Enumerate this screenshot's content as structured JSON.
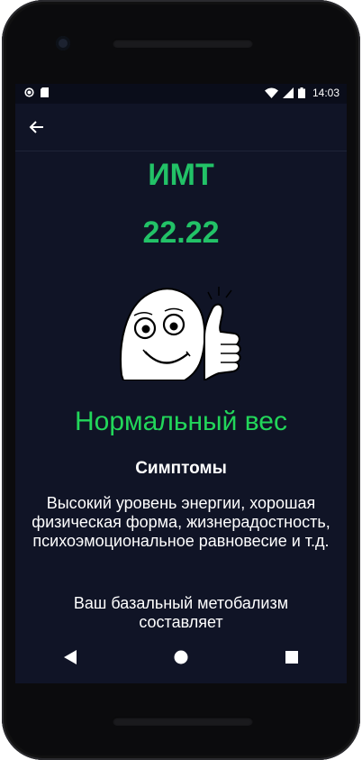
{
  "status_bar": {
    "time": "14:03",
    "left_icons": [
      "circle-notification-icon",
      "sd-card-icon"
    ],
    "right_icons": [
      "wifi-icon",
      "signal-icon",
      "battery-icon"
    ]
  },
  "app_bar": {
    "back_icon": "arrow-left-icon"
  },
  "result": {
    "title": "ИМТ",
    "value": "22.22",
    "accent_color": "#22c267",
    "category": "Нормальный вес",
    "category_color": "#22d65a",
    "symptoms_title": "Симптомы",
    "symptoms_text": "Высокий уровень энергии, хорошая физическая форма, жизнерадостность, психоэмоциональное равновесие и т.д.",
    "bmr_text": "Ваш базальный метобализм составляет"
  },
  "nav_bar": {
    "buttons": [
      "back-triangle-icon",
      "home-circle-icon",
      "recents-square-icon"
    ]
  }
}
